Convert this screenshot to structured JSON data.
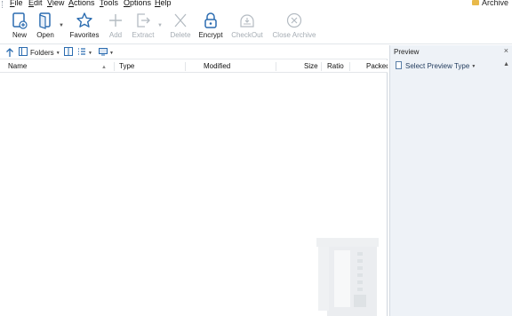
{
  "menu": {
    "items": [
      {
        "label": "File",
        "mnemonic": "F"
      },
      {
        "label": "Edit",
        "mnemonic": "E"
      },
      {
        "label": "View",
        "mnemonic": "V"
      },
      {
        "label": "Actions",
        "mnemonic": "A"
      },
      {
        "label": "Tools",
        "mnemonic": "T"
      },
      {
        "label": "Options",
        "mnemonic": "O"
      },
      {
        "label": "Help",
        "mnemonic": "H"
      }
    ],
    "archive_label": "Archive"
  },
  "toolbar": {
    "new": "New",
    "open": "Open",
    "favorites": "Favorites",
    "add": "Add",
    "extract": "Extract",
    "delete": "Delete",
    "encrypt": "Encrypt",
    "checkout": "CheckOut",
    "close_archive": "Close Archive"
  },
  "nav": {
    "folders_label": "Folders"
  },
  "columns": {
    "name": "Name",
    "type": "Type",
    "modified": "Modified",
    "size": "Size",
    "ratio": "Ratio",
    "packed": "Packed"
  },
  "preview": {
    "title": "Preview",
    "close": "×",
    "select_type": "Select Preview Type"
  },
  "colors": {
    "accent": "#2b6cb0",
    "disabled": "#a5acb3",
    "preview_bg": "#eef2f7"
  }
}
